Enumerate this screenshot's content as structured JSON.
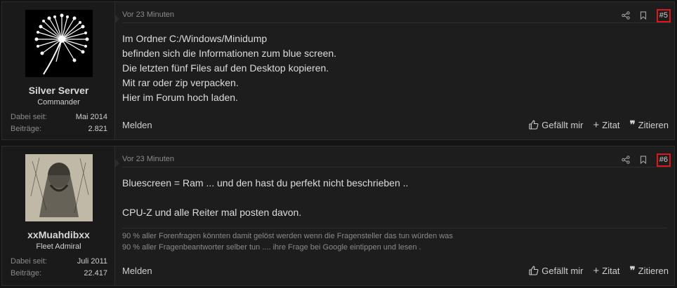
{
  "posts": [
    {
      "author": {
        "name": "Silver Server",
        "title": "Commander",
        "joined_label": "Dabei seit:",
        "joined_value": "Mai 2014",
        "posts_label": "Beiträge:",
        "posts_value": "2.821",
        "avatar_icon": "dandelion-avatar"
      },
      "time": "Vor 23 Minuten",
      "number": "#5",
      "lines": [
        "Im Ordner C:/Windows/Minidump",
        "befinden sich die Informationen zum blue screen.",
        "Die letzten fünf Files auf den Desktop kopieren.",
        "Mit rar oder zip verpacken.",
        "Hier im Forum hoch laden."
      ],
      "signature": [],
      "footer": {
        "report": "Melden",
        "like": "Gefällt mir",
        "quote_add": "Zitat",
        "quote": "Zitieren"
      }
    },
    {
      "author": {
        "name": "xxMuahdibxx",
        "title": "Fleet Admiral",
        "joined_label": "Dabei seit:",
        "joined_value": "Juli 2011",
        "posts_label": "Beiträge:",
        "posts_value": "22.417",
        "avatar_icon": "sketch-figure-avatar"
      },
      "time": "Vor 23 Minuten",
      "number": "#6",
      "lines": [
        "Bluescreen = Ram ... und den hast du perfekt nicht beschrieben ..",
        "",
        "CPU-Z und alle Reiter mal posten davon."
      ],
      "signature": [
        "90 % aller Forenfragen könnten damit gelöst werden wenn die Fragensteller das tun würden was",
        "90 % aller Fragenbeantworter selber tun .... ihre Frage bei Google eintippen und lesen ."
      ],
      "footer": {
        "report": "Melden",
        "like": "Gefällt mir",
        "quote_add": "Zitat",
        "quote": "Zitieren"
      }
    }
  ],
  "colors": {
    "page_bg": "#141414",
    "post_bg": "#1d1d1d",
    "text": "#dcdcdc",
    "muted": "#8a8a8a",
    "highlight_border": "#e0161c"
  }
}
